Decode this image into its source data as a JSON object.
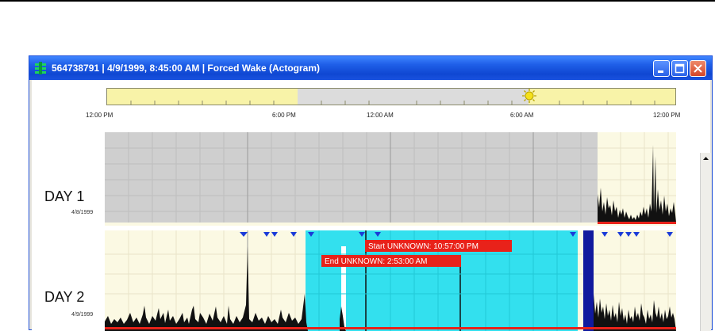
{
  "window": {
    "title": "564738791  |  4/9/1999, 8:45:00 AM  |  Forced Wake (Actogram)",
    "title_bar_color": "#1f5fe8"
  },
  "timebar": {
    "ticks": [
      "12:00 PM",
      "6:00 PM",
      "12:00 AM",
      "6:00 AM",
      "12:00 PM"
    ],
    "day_color": "#f8f3a8",
    "night_color": "#dcdcdc",
    "sunset_icon": "moon-icon",
    "sunrise_icon": "sun-icon"
  },
  "days": [
    {
      "label": "DAY 1",
      "date": "4/8/1999"
    },
    {
      "label": "DAY 2",
      "date": "4/9/1999"
    }
  ],
  "events": {
    "start_label": "Start UNKNOWN: 10:57:00 PM",
    "end_label": "End UNKNOWN: 2:53:00 AM",
    "highlight_color": "#33e0ee",
    "label_color": "#e8221a"
  },
  "icons": {
    "minimize": "minimize-icon",
    "maximize": "maximize-icon",
    "close": "close-icon"
  }
}
